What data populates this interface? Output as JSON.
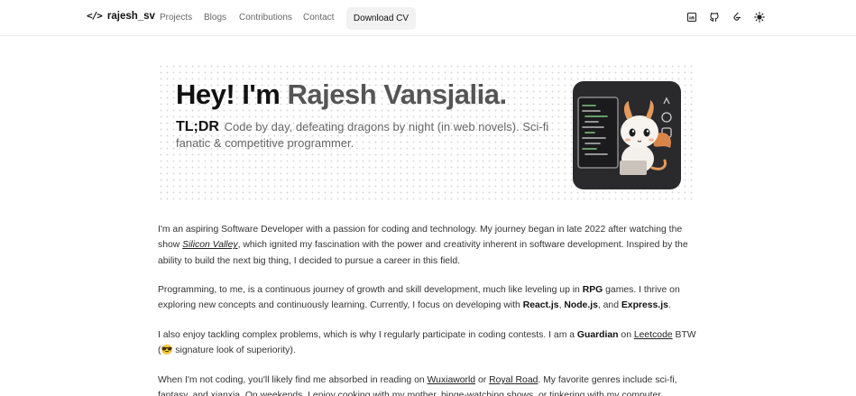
{
  "nav": {
    "logo_text": "rajesh_sv",
    "links": [
      "Projects",
      "Blogs",
      "Contributions",
      "Contact"
    ],
    "cv_button": "Download CV",
    "icons": [
      "linkedin-icon",
      "github-icon",
      "leetcode-icon",
      "theme-toggle-sun-icon"
    ]
  },
  "hero": {
    "greeting": "Hey! I'm ",
    "name": "Rajesh Vansjalia.",
    "tldr_label": "TL;DR",
    "tagline": "Code by day, defeating dragons by night (in web novels). Sci-fi fanatic & competitive programmer."
  },
  "about": {
    "p1_a": "I'm an aspiring Software Developer with a passion for coding and technology. My journey began in late 2022 after watching the show ",
    "p1_link": "Silicon Valley",
    "p1_b": ", which ignited my fascination with the power and creativity inherent in software development. Inspired by the ability to build the next big thing, I decided to pursue a career in this field.",
    "p2_a": "Programming, to me, is a continuous journey of growth and skill development, much like leveling up in ",
    "p2_rpg": "RPG",
    "p2_b": " games. I thrive on exploring new concepts and continuously learning. Currently, I focus on developing with ",
    "p2_react": "React.js",
    "p2_sep1": ", ",
    "p2_node": "Node.js",
    "p2_sep2": ", and ",
    "p2_express": "Express.js",
    "p2_end": ".",
    "p3_a": "I also enjoy tackling complex problems, which is why I regularly participate in coding contests. I am a ",
    "p3_guardian": "Guardian",
    "p3_b": " on ",
    "p3_link": "Leetcode",
    "p3_c": " BTW (",
    "p3_emoji": "😎",
    "p3_d": " signature look of superiority).",
    "p4_a": "When I'm not coding, you'll likely find me absorbed in reading on ",
    "p4_link1": "Wuxiaworld",
    "p4_b": " or ",
    "p4_link2": "Royal Road",
    "p4_c": ". My favorite genres include sci-fi, fantasy, and xianxia. On weekends, I enjoy cooking with my mother, binge-watching shows, or tinkering with my computer."
  },
  "colors": {
    "accent_bg": "#f2f2f2",
    "avatar_bg": "#2a2a2d"
  }
}
